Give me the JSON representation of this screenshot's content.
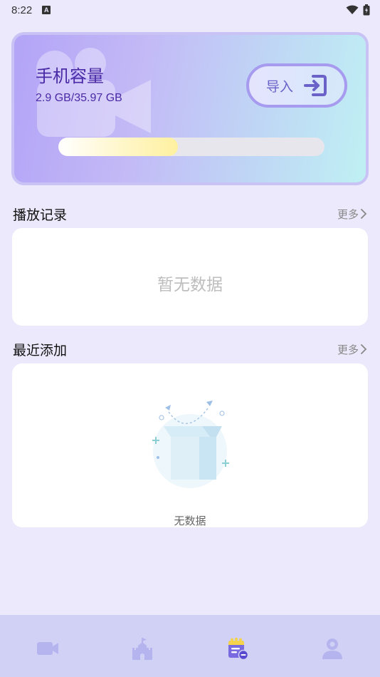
{
  "status": {
    "time": "8:22",
    "notif_badge": "A"
  },
  "storage": {
    "title": "手机容量",
    "usage": "2.9 GB/35.97 GB",
    "import_label": "导入",
    "progress_fraction": 0.45
  },
  "playback": {
    "title": "播放记录",
    "more": "更多",
    "empty": "暂无数据"
  },
  "recent": {
    "title": "最近添加",
    "more": "更多",
    "empty": "无数据"
  },
  "nav": {
    "items": [
      {
        "icon": "video-camera-icon",
        "active": false
      },
      {
        "icon": "castle-icon",
        "active": false
      },
      {
        "icon": "calendar-icon",
        "active": true
      },
      {
        "icon": "profile-icon",
        "active": false
      }
    ]
  },
  "colors": {
    "accent": "#6a5ad6",
    "nav_inactive": "#b6b4ee",
    "background": "#ebe9fb"
  }
}
